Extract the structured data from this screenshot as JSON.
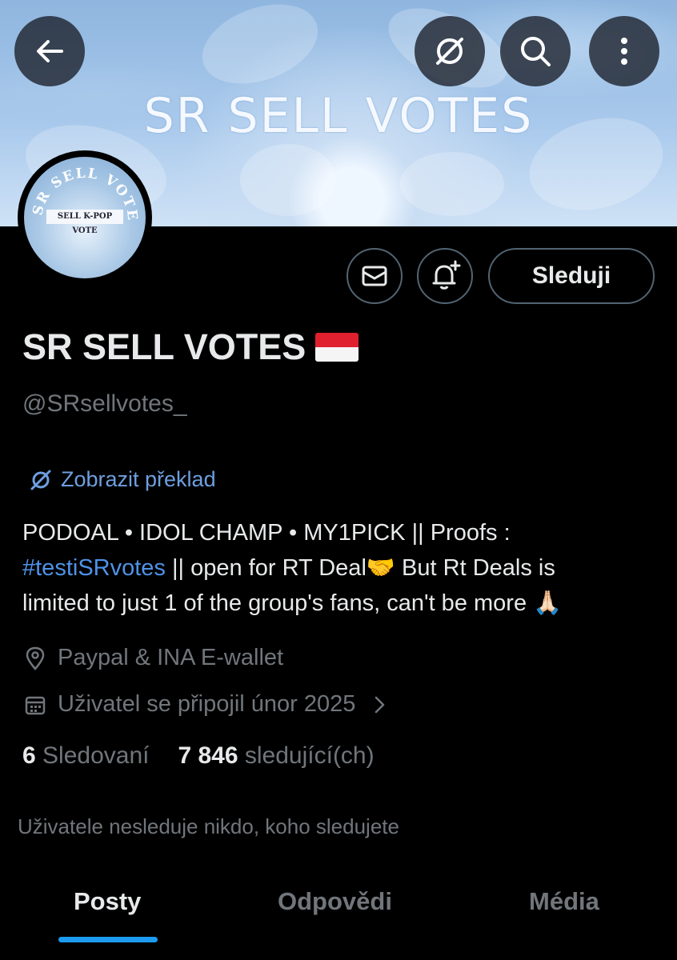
{
  "banner": {
    "title": "SR SELL VOTES"
  },
  "top_bar": {
    "back_icon": "arrow-left-icon",
    "translate_icon": "translate-icon",
    "search_icon": "search-icon",
    "more_icon": "more-vertical-icon"
  },
  "avatar": {
    "ring_text": "SR SELL VOTES",
    "label": "SELL K-POP VOTE"
  },
  "actions": {
    "message_icon": "envelope-icon",
    "notify_icon": "bell-plus-icon",
    "follow_label": "Sleduji"
  },
  "profile": {
    "name": "SR SELL VOTES",
    "flag": "indonesia-flag-icon",
    "handle": "@SRsellvotes_",
    "translate_label": "Zobrazit překlad",
    "bio_line1": "PODOAL • IDOL CHAMP • MY1PICK || Proofs :",
    "bio_hashtag": "#testiSRvotes",
    "bio_line2_rest": " || open for RT Deal🤝 But Rt Deals is",
    "bio_line3": "limited to just 1 of the group's fans, can't be more 🙏🏻",
    "location": "Paypal & INA E-wallet",
    "joined": "Uživatel se připojil únor 2025"
  },
  "stats": {
    "following_count": "6",
    "following_label": "Sledovaní",
    "followers_count": "7 846",
    "followers_label": "sledující(ch)"
  },
  "note": "Uživatele nesleduje nikdo, koho sledujete",
  "tabs": [
    {
      "label": "Posty",
      "active": true
    },
    {
      "label": "Odpovědi",
      "active": false
    },
    {
      "label": "Média",
      "active": false
    }
  ],
  "colors": {
    "accent": "#1d9bf0",
    "link": "#4f92e8",
    "muted": "#71767b"
  }
}
